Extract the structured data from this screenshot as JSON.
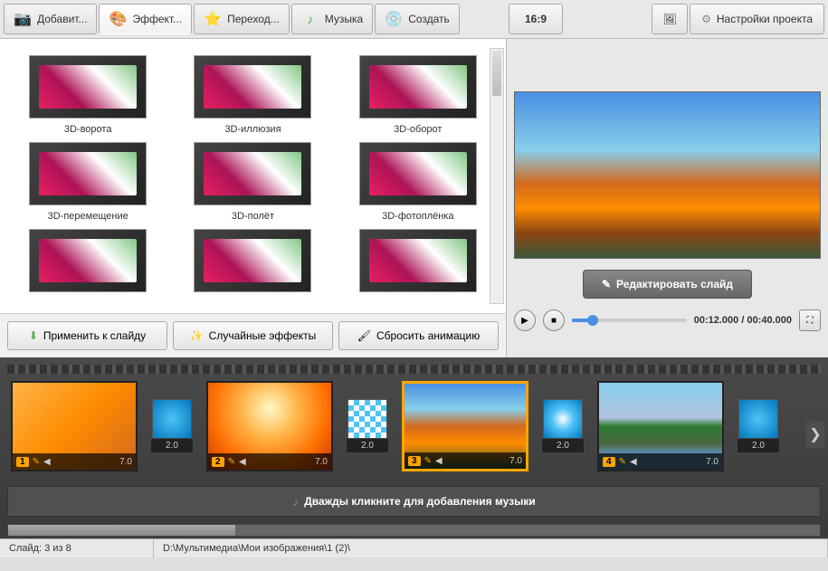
{
  "tabs": {
    "add": "Добавит...",
    "effects": "Эффект...",
    "transitions": "Переход...",
    "music": "Музыка",
    "create": "Создать"
  },
  "toolbar_right": {
    "aspect": "16:9",
    "project_settings": "Настройки проекта"
  },
  "effects": {
    "items": [
      {
        "label": "3D-ворота"
      },
      {
        "label": "3D-иллюзия"
      },
      {
        "label": "3D-оборот"
      },
      {
        "label": "3D-перемещение"
      },
      {
        "label": "3D-полёт"
      },
      {
        "label": "3D-фотоплёнка"
      },
      {
        "label": ""
      },
      {
        "label": ""
      },
      {
        "label": ""
      }
    ],
    "apply": "Применить к слайду",
    "random": "Случайные эффекты",
    "reset": "Сбросить анимацию"
  },
  "preview": {
    "edit_slide": "Редактировать слайд",
    "time": "00:12.000 / 00:40.000"
  },
  "timeline": {
    "slides": [
      {
        "num": "1",
        "dur": "7.0",
        "img": "autumn1"
      },
      {
        "num": "2",
        "dur": "7.0",
        "img": "sunset"
      },
      {
        "num": "3",
        "dur": "7.0",
        "img": "autumn2",
        "selected": true
      },
      {
        "num": "4",
        "dur": "7.0",
        "img": "lake"
      }
    ],
    "transitions": [
      {
        "dur": "2.0",
        "style": ""
      },
      {
        "dur": "2.0",
        "style": "checker"
      },
      {
        "dur": "2.0",
        "style": "burst"
      },
      {
        "dur": "2.0",
        "style": ""
      }
    ],
    "music_prompt": "Дважды кликните для добавления музыки"
  },
  "status": {
    "slide_info": "Слайд: 3 из 8",
    "path": "D:\\Мультимедиа\\Мои изображения\\1 (2)\\"
  },
  "icons": {
    "pencil": "✎",
    "sound": "◀",
    "play": "▶",
    "stop": "■",
    "fullscreen": "⛶",
    "arrow_right": "❯",
    "note": "♪",
    "gear": "⚙",
    "camera": "📷",
    "palette": "🎨",
    "star": "⭐",
    "wand": "✨",
    "brush": "🖌",
    "arrow_down": "⬇",
    "disc": "💿",
    "picture": "🖼"
  }
}
